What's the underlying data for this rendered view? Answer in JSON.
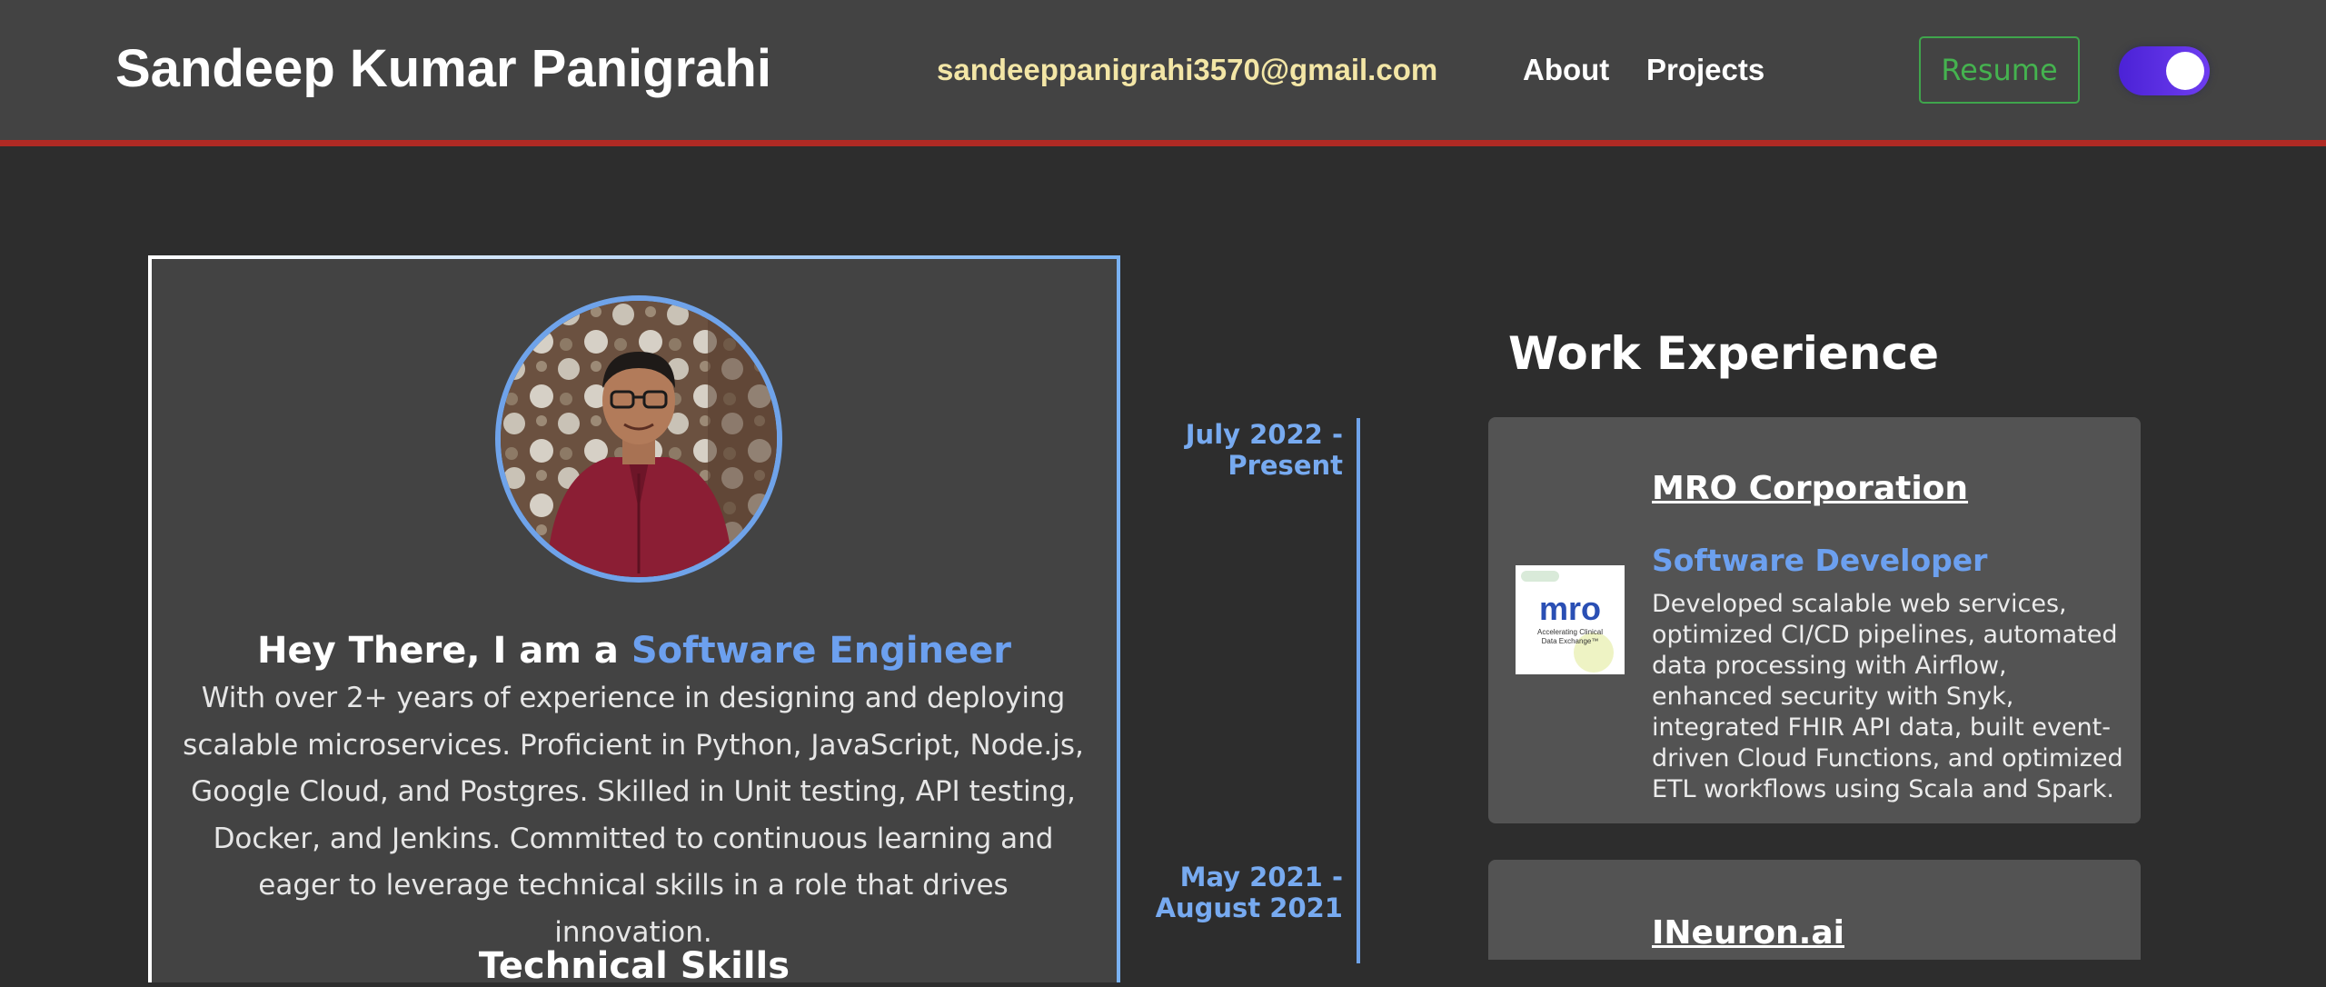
{
  "header": {
    "brand": "Sandeep Kumar Panigrahi",
    "email": "sandeeppanigrahi3570@gmail.com",
    "nav": [
      "About",
      "Projects"
    ],
    "resume_label": "Resume",
    "theme_toggle_on": true
  },
  "profile": {
    "intro_prefix": "Hey There, I am a",
    "intro_role": "Software Engineer",
    "bio": "With over 2+ years of experience in designing and deploying scalable microservices. Proficient in Python, JavaScript, Node.js, Google Cloud, and Postgres. Skilled in Unit testing, API testing, Docker, and Jenkins. Committed to continuous learning and eager to leverage technical skills in a role that drives innovation.",
    "skills_heading": "Technical Skills"
  },
  "work": {
    "title": "Work Experience",
    "jobs": [
      {
        "date_line1": "July 2022 -",
        "date_line2": "Present",
        "company": "MRO Corporation",
        "role": "Software Developer",
        "logo_text": "mro",
        "logo_tagline": "Accelerating Clinical Data Exchange™",
        "description": "Developed scalable web services, optimized CI/CD pipelines, automated data processing with Airflow, enhanced security with Snyk, integrated FHIR API data, built event-driven Cloud Functions, and optimized ETL workflows using Scala and Spark."
      },
      {
        "date_line1": "May 2021 -",
        "date_line2": "August 2021",
        "company": "INeuron.ai"
      }
    ]
  },
  "colors": {
    "accent_blue": "#6ca0ef",
    "header_border": "#b02a24",
    "email_yellow": "#f3e6a6",
    "resume_green": "#45b24f",
    "toggle_purple": "#5a2ee0"
  }
}
